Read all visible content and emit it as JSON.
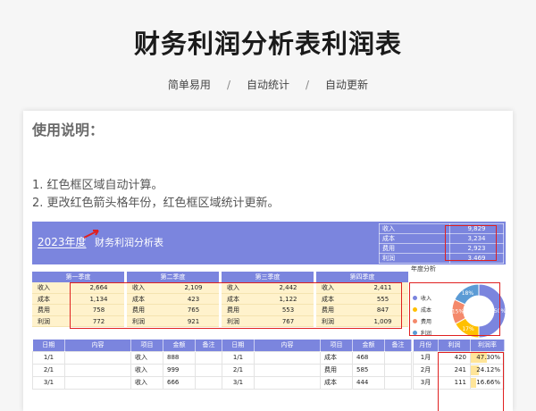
{
  "page": {
    "title": "财务利润分析表利润表",
    "taglines": [
      "简单易用",
      "自动统计",
      "自动更新"
    ],
    "separator": "/"
  },
  "instructions": {
    "title": "使用说明：",
    "lines": [
      "1. 红色框区域自动计算。",
      "2. 更改红色箭头格年份，红色框区域统计更新。"
    ]
  },
  "banner": {
    "year": "2023年度",
    "title": "财务利润分析表",
    "summary": [
      {
        "label": "收入",
        "value": "9,829"
      },
      {
        "label": "成本",
        "value": "3,234"
      },
      {
        "label": "费用",
        "value": "2,923"
      },
      {
        "label": "利润",
        "value": "3,469"
      }
    ]
  },
  "quarters": [
    {
      "name": "第一季度",
      "rows": [
        {
          "k": "收入",
          "v": "2,664"
        },
        {
          "k": "成本",
          "v": "1,134"
        },
        {
          "k": "费用",
          "v": "758"
        },
        {
          "k": "利润",
          "v": "772"
        }
      ]
    },
    {
      "name": "第二季度",
      "rows": [
        {
          "k": "收入",
          "v": "2,109"
        },
        {
          "k": "成本",
          "v": "423"
        },
        {
          "k": "费用",
          "v": "765"
        },
        {
          "k": "利润",
          "v": "921"
        }
      ]
    },
    {
      "name": "第三季度",
      "rows": [
        {
          "k": "收入",
          "v": "2,442"
        },
        {
          "k": "成本",
          "v": "1,122"
        },
        {
          "k": "费用",
          "v": "553"
        },
        {
          "k": "利润",
          "v": "767"
        }
      ]
    },
    {
      "name": "第四季度",
      "rows": [
        {
          "k": "收入",
          "v": "2,411"
        },
        {
          "k": "成本",
          "v": "555"
        },
        {
          "k": "费用",
          "v": "847"
        },
        {
          "k": "利润",
          "v": "1,009"
        }
      ]
    }
  ],
  "donut": {
    "title": "年度分析",
    "legend": [
      "收入",
      "成本",
      "费用",
      "利润"
    ],
    "slices": [
      {
        "name": "收入",
        "value": 50,
        "label": "50%",
        "color": "#7b85de"
      },
      {
        "name": "成本",
        "value": 17,
        "label": "17%",
        "color": "#ffc000"
      },
      {
        "name": "费用",
        "value": 15,
        "label": "15%",
        "color": "#f4896b"
      },
      {
        "name": "利润",
        "value": 18,
        "label": "18%",
        "color": "#5b9bd5"
      }
    ]
  },
  "incomeTable": {
    "headers": [
      "日期",
      "内容",
      "项目",
      "金额",
      "备注"
    ],
    "rows": [
      [
        "1/1",
        "",
        "收入",
        "888",
        ""
      ],
      [
        "2/1",
        "",
        "收入",
        "999",
        ""
      ],
      [
        "3/1",
        "",
        "收入",
        "666",
        ""
      ]
    ]
  },
  "costTable": {
    "headers": [
      "日期",
      "内容",
      "项目",
      "金额",
      "备注"
    ],
    "rows": [
      [
        "1/1",
        "",
        "成本",
        "468",
        ""
      ],
      [
        "2/1",
        "",
        "费用",
        "585",
        ""
      ],
      [
        "3/1",
        "",
        "成本",
        "444",
        ""
      ]
    ]
  },
  "profitTable": {
    "headers": [
      "月份",
      "利润",
      "利润率"
    ],
    "rows": [
      {
        "month": "1月",
        "profit": "420",
        "rate": "47.30%",
        "pct": 0.473
      },
      {
        "month": "2月",
        "profit": "241",
        "rate": "24.12%",
        "pct": 0.2412
      },
      {
        "month": "3月",
        "profit": "111",
        "rate": "16.66%",
        "pct": 0.1666
      }
    ]
  }
}
